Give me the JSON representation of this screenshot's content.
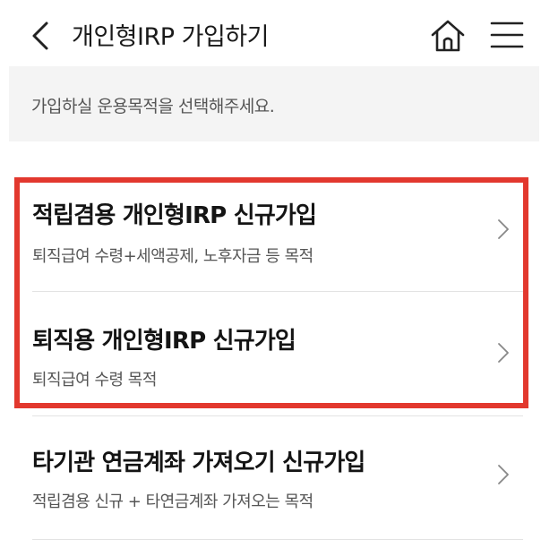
{
  "header": {
    "title": "개인형IRP 가입하기",
    "back_icon": "chevron-left-icon",
    "home_icon": "home-icon",
    "menu_icon": "hamburger-menu-icon"
  },
  "notice": {
    "text": "가입하실 운용목적을 선택해주세요."
  },
  "options": [
    {
      "title": "적립겸용 개인형IRP 신규가입",
      "desc": "퇴직급여 수령+세액공제, 노후자금 등 목적",
      "highlighted": true
    },
    {
      "title": "퇴직용 개인형IRP 신규가입",
      "desc": "퇴직급여 수령 목적",
      "highlighted": true
    },
    {
      "title": "타기관 연금계좌 가져오기 신규가입",
      "desc": "적립겸용 신규 + 타연금계좌 가져오는 목적",
      "highlighted": false
    }
  ],
  "colors": {
    "highlight_border": "#e2382e",
    "notice_bg": "#f4f4f4",
    "divider": "#e3e3e3"
  }
}
